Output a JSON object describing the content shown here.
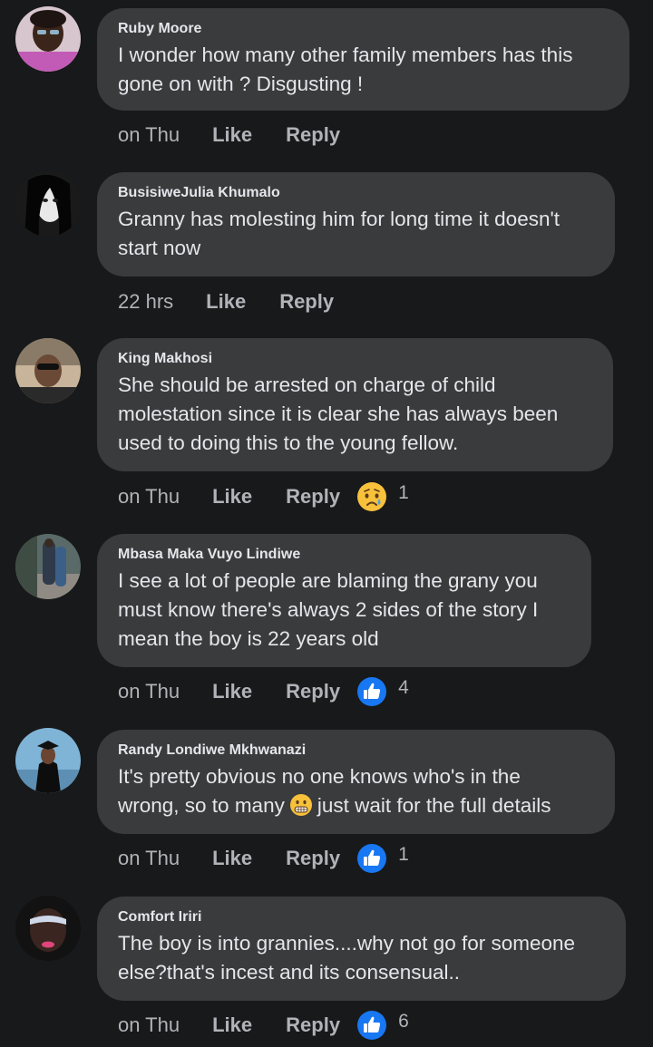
{
  "comments": [
    {
      "author": "Ruby Moore",
      "text": "I wonder how many other family members has this\ngone on with ? Disgusting !",
      "time": "on Thu",
      "like_label": "Like",
      "reply_label": "Reply",
      "reaction": null,
      "reaction_count": ""
    },
    {
      "author": "BusisiweJulia Khumalo",
      "text": "Granny has molesting him for long time it doesn't\nstart now",
      "time": "22 hrs",
      "like_label": "Like",
      "reply_label": "Reply",
      "reaction": null,
      "reaction_count": ""
    },
    {
      "author": "King Makhosi",
      "text": "She should be arrested on charge of child\nmolestation since it is clear she has always been\nused to doing this to the young fellow.",
      "time": "on Thu",
      "like_label": "Like",
      "reply_label": "Reply",
      "reaction": "sad-reaction-icon",
      "reaction_count": "1"
    },
    {
      "author": "Mbasa Maka Vuyo Lindiwe",
      "text": "I see a lot of people are blaming the grany you\nmust know there's always 2 sides of the story I\nmean the boy is 22 years old",
      "time": "on Thu",
      "like_label": "Like",
      "reply_label": "Reply",
      "reaction": "like-reaction-icon",
      "reaction_count": "4"
    },
    {
      "author": "Randy Londiwe Mkhwanazi",
      "text_line1": "It's pretty obvious no one knows who's in the",
      "text_line2_before": "wrong, so to many",
      "text_line2_after": "just wait for the full details",
      "inline_emoji": "grimace-emoji-icon",
      "time": "on Thu",
      "like_label": "Like",
      "reply_label": "Reply",
      "reaction": "like-reaction-icon",
      "reaction_count": "1"
    },
    {
      "author": "Comfort Iriri",
      "text": "The boy is into grannies....why not go for someone\nelse?that's incest and its consensual..",
      "time": "on Thu",
      "like_label": "Like",
      "reply_label": "Reply",
      "reaction": "like-reaction-icon",
      "reaction_count": "6"
    }
  ],
  "colors": {
    "background": "#18191a",
    "bubble": "#3a3b3c",
    "text": "#e4e6eb",
    "secondary": "#b0b3b8",
    "like_blue": "#1877f2"
  }
}
